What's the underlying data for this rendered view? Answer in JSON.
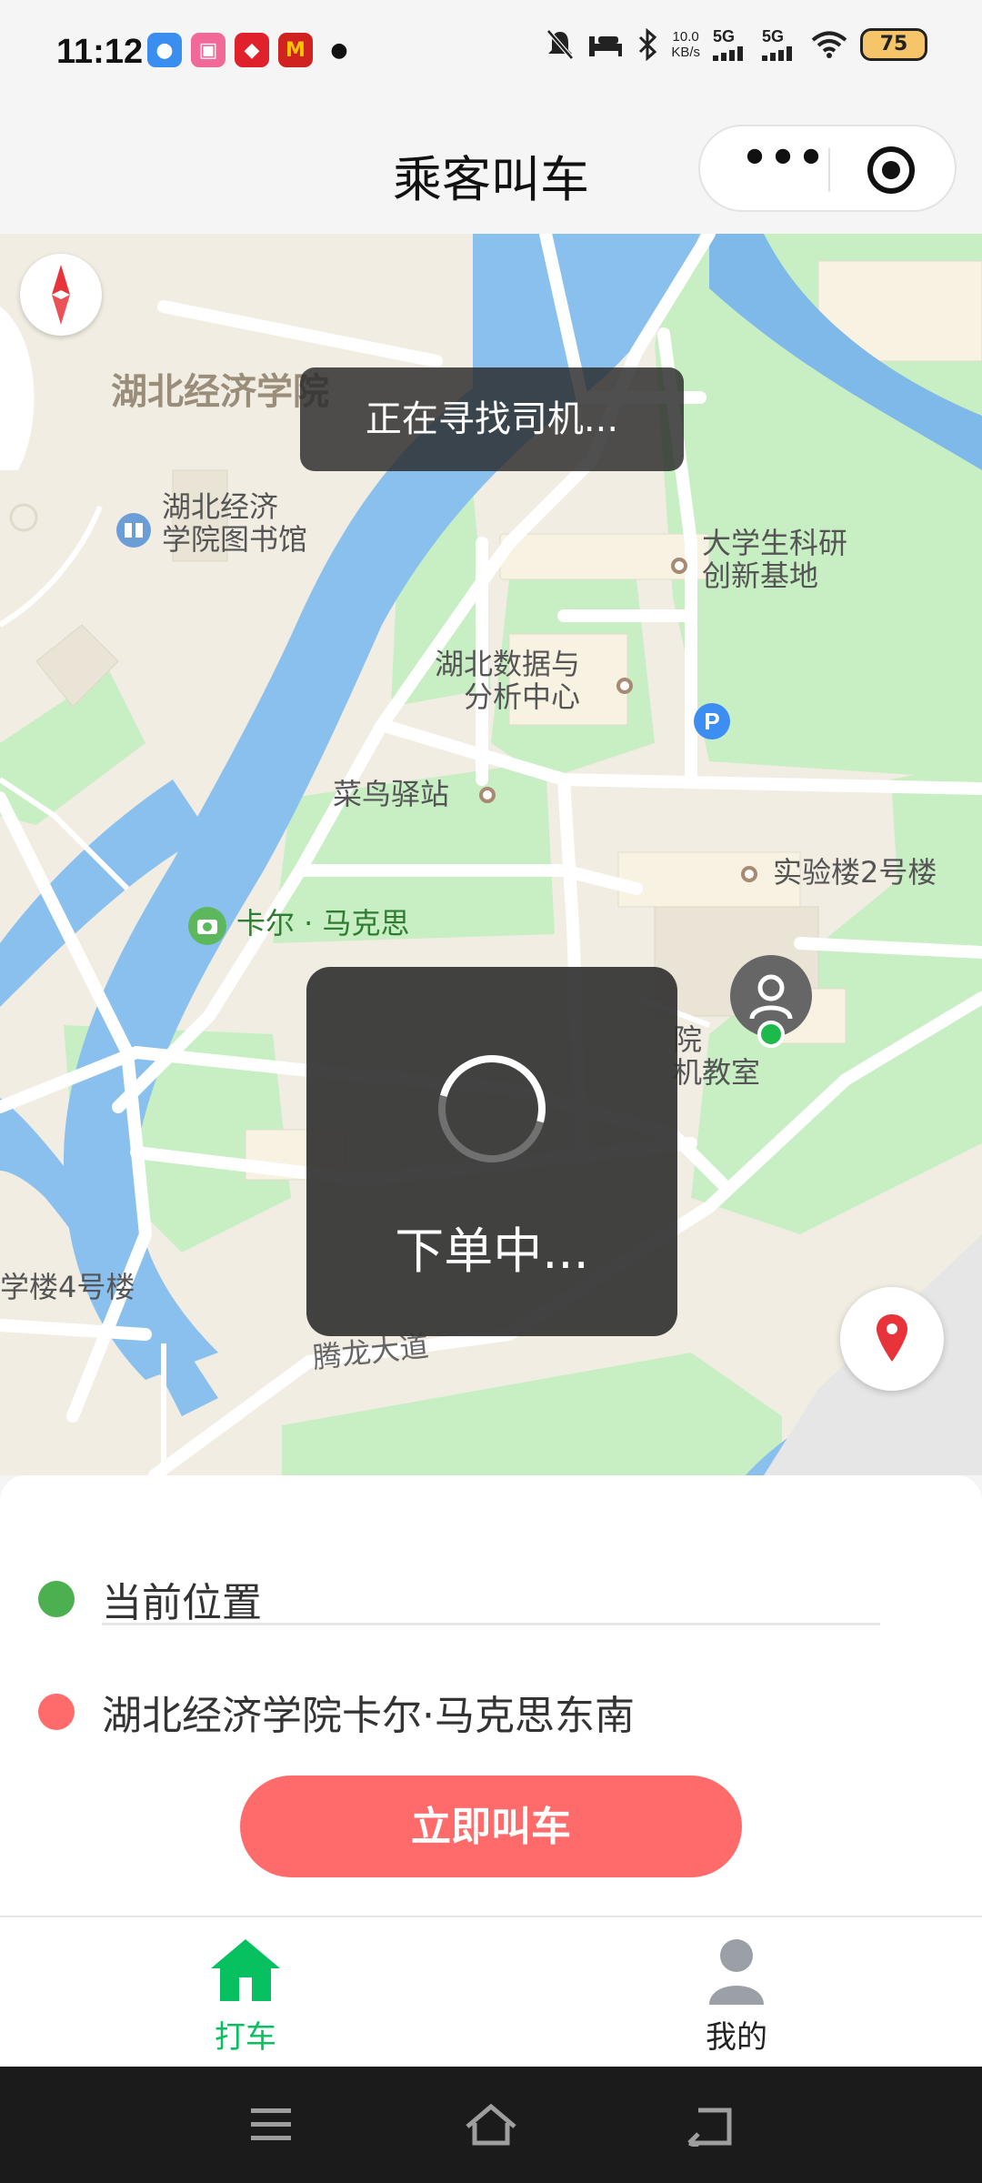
{
  "status_bar": {
    "time": "11:12",
    "net_speed_value": "10.0",
    "net_speed_unit": "KB/s",
    "signal1": "5G",
    "signal2": "5G",
    "battery": "75",
    "app_icons": [
      "baidu-icon",
      "bilibili-icon",
      "checker-app-icon",
      "mcdonalds-icon",
      "qq-penguin-icon"
    ]
  },
  "navbar": {
    "title": "乘客叫车"
  },
  "map": {
    "labels": {
      "hbue_campus": "湖北经济学院",
      "library": "湖北经济\n学院图书馆",
      "innovation_base": "大学生科研\n创新基地",
      "data_center": "湖北数据与\n分析中心",
      "cainiao": "菜鸟驿站",
      "lab_building": "实验楼2号楼",
      "karl_marx": "卡尔 · 马克思",
      "classroom_partial": "院\n机教室",
      "teaching_building": "学楼4号楼",
      "road": "腾龙大道"
    },
    "toast_top": "正在寻找司机...",
    "loading_text": "下单中..."
  },
  "panel": {
    "start_label": "当前位置",
    "destination_label": "湖北经济学院卡尔·马克思东南",
    "call_button": "立即叫车",
    "colors": {
      "start_dot": "#4caf50",
      "dest_dot": "#ff6b6b",
      "button": "#ff6b6b"
    }
  },
  "tabbar": {
    "tabs": [
      {
        "label": "打车",
        "icon": "home-icon",
        "active": true,
        "color": "#07c160"
      },
      {
        "label": "我的",
        "icon": "user-icon",
        "active": false,
        "color": "#222222"
      }
    ]
  }
}
